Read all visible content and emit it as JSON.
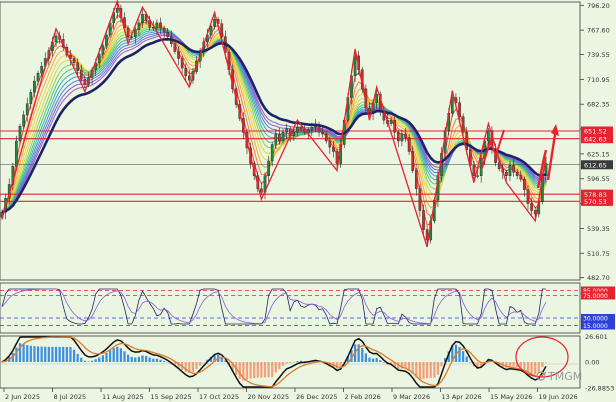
{
  "chart_data": {
    "type": "candlestick",
    "x_ticks": [
      "2 Jun 2025",
      "8 Jul 2025",
      "11 Aug 2025",
      "15 Sep 2025",
      "17 Oct 2025",
      "20 Nov 2025",
      "26 Dec 2025",
      "2 Feb 2026",
      "9 Mar 2026",
      "13 Apr 2026",
      "15 May 2026",
      "19 Jun 2026"
    ],
    "price_ticks": [
      796.2,
      767.6,
      739.55,
      710.95,
      682.35,
      653.75,
      625.15,
      596.55,
      568.0,
      539.35,
      510.75,
      482.7
    ],
    "ylim": [
      480.0,
      800.0
    ],
    "price_levels": [
      {
        "value": 651.52,
        "label": "651.52",
        "color": "#e8222e"
      },
      {
        "value": 642.63,
        "label": "642.63",
        "color": "#e8222e"
      },
      {
        "value": 612.65,
        "label": "612.65",
        "color": "#3a3a3a"
      },
      {
        "value": 578.83,
        "label": "578.83",
        "color": "#e8222e"
      },
      {
        "value": 570.53,
        "label": "570.53",
        "color": "#e8222e"
      }
    ],
    "series": [
      {
        "name": "",
        "kind": "candles",
        "values": [
          558,
          574,
          590,
          611,
          640,
          657,
          670,
          683,
          696,
          709,
          718,
          726,
          735,
          744,
          754,
          761,
          757,
          748,
          739,
          735,
          730,
          721,
          711,
          705,
          713,
          722,
          730,
          740,
          750,
          762,
          776,
          788,
          793,
          782,
          770,
          760,
          760,
          768,
          776,
          786,
          779,
          771,
          770,
          776,
          770,
          765,
          760,
          752,
          743,
          735,
          724,
          715,
          710,
          720,
          732,
          744,
          754,
          762,
          772,
          780,
          775,
          760,
          742,
          722,
          700,
          682,
          666,
          650,
          632,
          614,
          600,
          585,
          581,
          600,
          617,
          636,
          648,
          640,
          650,
          654,
          646,
          650,
          656,
          654,
          650,
          653,
          656,
          658,
          650,
          648,
          640,
          633,
          628,
          614,
          636,
          664,
          690,
          715,
          738,
          722,
          700,
          678,
          672,
          684,
          694,
          675,
          664,
          660,
          664,
          650,
          640,
          648,
          644,
          628,
          606,
          585,
          560,
          538,
          526,
          548,
          572,
          600,
          626,
          652,
          672,
          690,
          684,
          668,
          650,
          630,
          612,
          600,
          600,
          620,
          640,
          652,
          630,
          615,
          608,
          604,
          600,
          612,
          604,
          600,
          596,
          584,
          568,
          560,
          556,
          570,
          600,
          614
        ]
      }
    ],
    "rsi_panel": {
      "ylim": [
        0,
        100
      ],
      "levels": [
        {
          "value": 85.0,
          "label": "85.0000",
          "color": "#e8222e"
        },
        {
          "value": 75.0,
          "label": "75.0000",
          "color": "#e8222e"
        },
        {
          "value": 30.0,
          "label": "30.0000",
          "color": "#2d40d8"
        },
        {
          "value": 15.0,
          "label": "15.0000",
          "color": "#2d40d8"
        }
      ]
    },
    "macd_panel": {
      "ticks": [
        26.601,
        0.0,
        -26.8853
      ],
      "tick_labels": [
        "26.601",
        "0.00",
        "-26.8853"
      ],
      "ylim": [
        -27,
        27
      ]
    }
  },
  "colors": {
    "background": "#eaf6e2",
    "candle_up": "#1f8a3e",
    "candle_down": "#c8322c",
    "moving_average": "#1d2466",
    "zigzag": "#e8222e",
    "hist_pos": "#3d8fe0",
    "hist_neg": "#f2a07b",
    "panel_border": "#3a3a3a"
  },
  "watermark": "TMGM"
}
